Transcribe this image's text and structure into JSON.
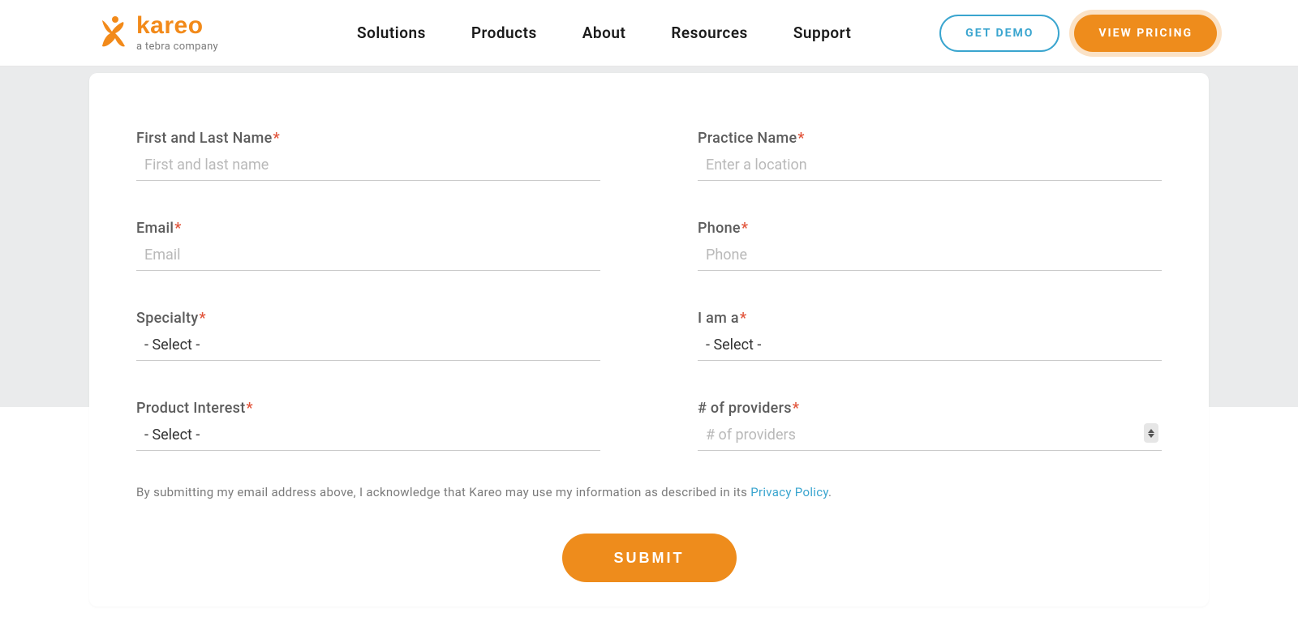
{
  "brand": {
    "name": "kareo",
    "tagline": "a tebra company",
    "accent": "#f28a1a"
  },
  "nav": {
    "items": [
      "Solutions",
      "Products",
      "About",
      "Resources",
      "Support"
    ]
  },
  "cta": {
    "demo": "GET DEMO",
    "pricing": "VIEW PRICING"
  },
  "form": {
    "fields": {
      "name": {
        "label": "First and Last Name",
        "placeholder": "First and last name",
        "required": true
      },
      "practice": {
        "label": "Practice Name",
        "placeholder": "Enter a location",
        "required": true
      },
      "email": {
        "label": "Email",
        "placeholder": "Email",
        "required": true
      },
      "phone": {
        "label": "Phone",
        "placeholder": "Phone",
        "required": true
      },
      "specialty": {
        "label": "Specialty",
        "selected": "- Select -",
        "required": true
      },
      "role": {
        "label": "I am a",
        "selected": "- Select -",
        "required": true
      },
      "product": {
        "label": "Product Interest",
        "selected": "- Select -",
        "required": true
      },
      "providers": {
        "label": "# of providers",
        "placeholder": "# of providers",
        "required": true
      }
    },
    "consent": {
      "text_before": "By submitting my email address above, I acknowledge that Kareo may use my information as described in its ",
      "link_label": "Privacy Policy",
      "text_after": "."
    },
    "submit_label": "SUBMIT",
    "required_mark": "*"
  }
}
